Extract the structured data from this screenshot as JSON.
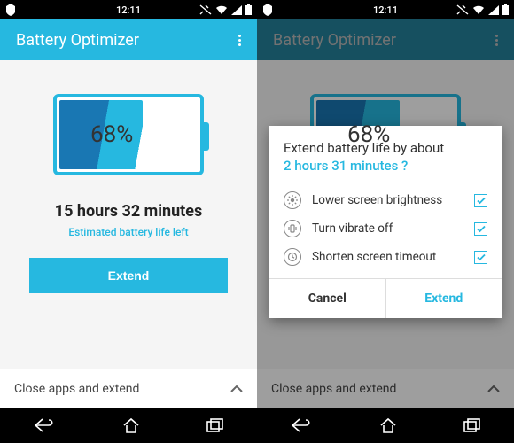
{
  "statusbar": {
    "time": "12:11"
  },
  "appbar": {
    "title": "Battery Optimizer"
  },
  "main": {
    "battery_pct": "68%",
    "est_time": "15 hours 32 minutes",
    "est_label": "Estimated battery life left",
    "extend_btn": "Extend"
  },
  "expander": {
    "label": "Close apps and extend"
  },
  "dialog": {
    "line1": "Extend battery life by about",
    "line2": "2 hours 31 minutes ?",
    "options": [
      {
        "label": "Lower screen brightness",
        "checked": true
      },
      {
        "label": "Turn vibrate off",
        "checked": true
      },
      {
        "label": "Shorten screen timeout",
        "checked": true
      }
    ],
    "cancel": "Cancel",
    "confirm": "Extend"
  }
}
